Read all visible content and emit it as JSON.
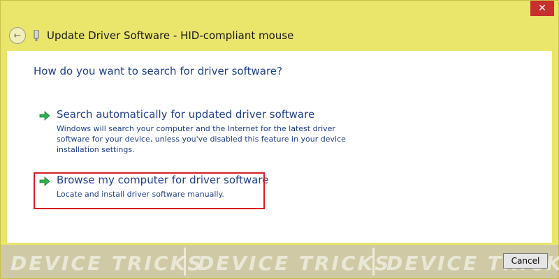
{
  "window": {
    "title": "Update Driver Software - HID-compliant mouse",
    "close_symbol": "✕",
    "back_symbol": "←"
  },
  "dialog": {
    "heading": "How do you want to search for driver software?",
    "options": [
      {
        "title": "Search automatically for updated driver software",
        "description": "Windows will search your computer and the Internet for the latest driver software for your device, unless you've disabled this feature in your device installation settings.",
        "icon": "green-arrow-icon"
      },
      {
        "title": "Browse my computer for driver software",
        "description": "Locate and install driver software manually.",
        "icon": "green-arrow-icon",
        "highlighted": true
      }
    ]
  },
  "footer": {
    "cancel_label": "Cancel",
    "watermark_text": "DEVICE TRICKS"
  },
  "colors": {
    "window_frame": "#eae56b",
    "link_text": "#1f3e8a",
    "highlight_border": "#d91c24",
    "close_button": "#c7302d"
  }
}
